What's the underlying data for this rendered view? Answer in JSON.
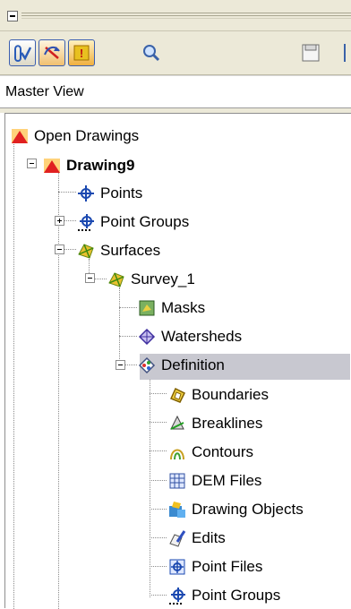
{
  "panel": {
    "view_label": "Master View"
  },
  "toolbar": {
    "buttons": [
      {
        "icon": "check-drawing-icon"
      },
      {
        "icon": "no-update-icon"
      },
      {
        "icon": "warning-icon"
      },
      {
        "icon": "magnify-icon"
      },
      {
        "icon": "save-icon"
      }
    ]
  },
  "tree": {
    "open_drawings": "Open Drawings",
    "drawing": "Drawing9",
    "points": "Points",
    "point_groups": "Point Groups",
    "surfaces": "Surfaces",
    "surface": "Survey_1",
    "masks": "Masks",
    "watersheds": "Watersheds",
    "definition": "Definition",
    "definition_items": [
      "Boundaries",
      "Breaklines",
      "Contours",
      "DEM Files",
      "Drawing Objects",
      "Edits",
      "Point Files",
      "Point Groups"
    ]
  }
}
